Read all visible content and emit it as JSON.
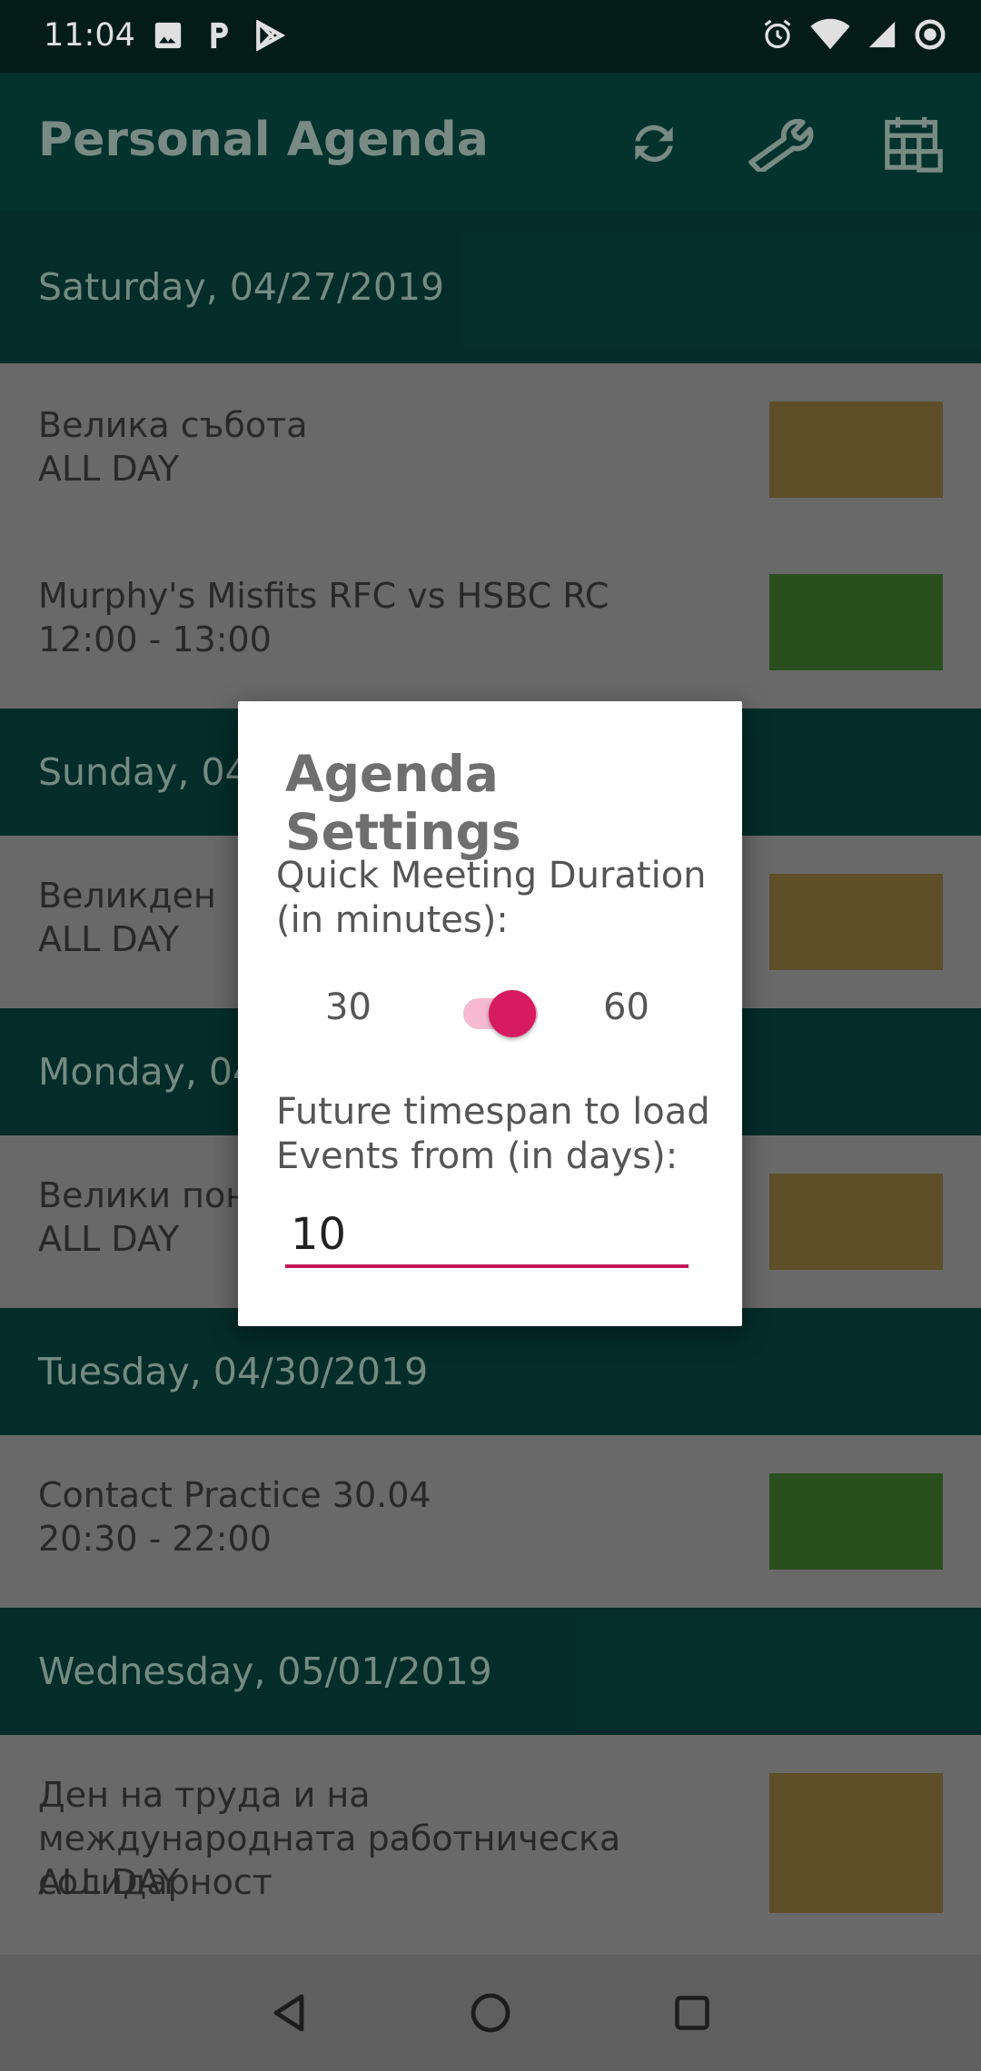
{
  "status_bar": {
    "time": "11:04",
    "left_icons": [
      "image-icon",
      "parking-icon",
      "play-store-icon"
    ],
    "right_icons": [
      "alarm-icon",
      "wifi-icon",
      "signal-icon",
      "record-icon"
    ]
  },
  "app_bar": {
    "title": "Personal Agenda",
    "actions": [
      "refresh-icon",
      "wrench-icon",
      "calendar-icon"
    ]
  },
  "agenda": {
    "days": [
      {
        "date": "Saturday, 04/27/2019",
        "events": [
          {
            "title": "Велика събота",
            "time": "ALL DAY",
            "color": "#6b5a2e"
          },
          {
            "title": "Murphy's Misfits RFC vs HSBC RC",
            "time": "12:00 - 13:00",
            "color": "#2f5a22"
          }
        ]
      },
      {
        "date": "Sunday, 04/",
        "events": [
          {
            "title": "Великден",
            "time": "ALL DAY",
            "color": "#6b5a2e"
          }
        ]
      },
      {
        "date": "Monday, 04",
        "events": [
          {
            "title": "Велики пон",
            "time": "ALL DAY",
            "color": "#6b5a2e"
          }
        ]
      },
      {
        "date": "Tuesday, 04/30/2019",
        "events": [
          {
            "title": "Contact Practice 30.04",
            "time": "20:30 - 22:00",
            "color": "#2f5a22"
          }
        ]
      },
      {
        "date": "Wednesday, 05/01/2019",
        "events": [
          {
            "title": "Ден на труда и на международната работническа солидарност",
            "time": "ALL DAY",
            "color": "#6b5a2e"
          }
        ]
      }
    ]
  },
  "dialog": {
    "title": "Agenda Settings",
    "duration_label": "Quick Meeting Duration (in minutes):",
    "switch_off_label": "30",
    "switch_on_label": "60",
    "switch_on": true,
    "timespan_label": "Future timespan to load Events from (in days):",
    "timespan_value": "10"
  },
  "colors": {
    "accent": "#d81b60",
    "app_bar": "#053a33",
    "header": "#05342f"
  },
  "nav_bar": {
    "buttons": [
      "back-icon",
      "home-icon",
      "recents-icon"
    ]
  }
}
